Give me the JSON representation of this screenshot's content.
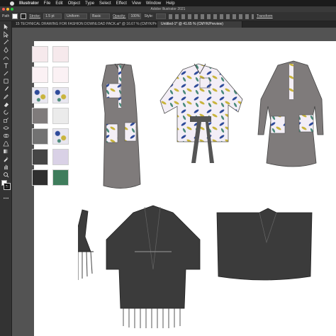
{
  "menubar": {
    "app": "Illustrator",
    "items": [
      "File",
      "Edit",
      "Object",
      "Type",
      "Select",
      "Effect",
      "View",
      "Window",
      "Help"
    ]
  },
  "titlebar": {
    "title": "Adobe Illustrator 2021"
  },
  "control": {
    "label_path": "Path",
    "stroke_label": "Stroke:",
    "stroke_value": "1.5 pt",
    "uniform": "Uniform",
    "basic": "Basic",
    "opacity_label": "Opacity:",
    "opacity_value": "100%",
    "style_label": "Style:",
    "transform": "Transform"
  },
  "tabs": [
    {
      "label": "15 TECHNICAL DRAWING FOR FASHION DOWNLOAD PACK.ai* @ 16.67 % (CMYK/Preview)",
      "active": false
    },
    {
      "label": "Untitled-1* @ 41.65 % (CMYK/Preview)",
      "active": true
    }
  ],
  "colors": {
    "accent": "#2a7bd5",
    "grey_garment": "#7f7b7b",
    "dark_garment": "#3b3b3b",
    "green_swatch": "#3f7d5c",
    "pink_swatch": "#f4e6ea"
  },
  "swatches": [
    {
      "name": "pink-light",
      "color": "#f6e9ec"
    },
    {
      "name": "pink-light-2",
      "color": "#f6e9ec"
    },
    {
      "name": "pink-lighter",
      "color": "#fbf1f4"
    },
    {
      "name": "pink-lighter-2",
      "color": "#fbf1f4"
    },
    {
      "name": "leaf-print",
      "color": "#e8e6ef"
    },
    {
      "name": "leaf-print-2",
      "color": "#e8e6ef"
    },
    {
      "name": "mid-grey",
      "color": "#7f7b7b"
    },
    {
      "name": "light-grey",
      "color": "#ebebeb"
    },
    {
      "name": "grey",
      "color": "#727272"
    },
    {
      "name": "leaf-print-3",
      "color": "#e8e6ef"
    },
    {
      "name": "dark-grey",
      "color": "#454545"
    },
    {
      "name": "print-purple",
      "color": "#d9d1e6"
    },
    {
      "name": "charcoal",
      "color": "#2f2f2f"
    },
    {
      "name": "green",
      "color": "#3f7d5c"
    }
  ]
}
